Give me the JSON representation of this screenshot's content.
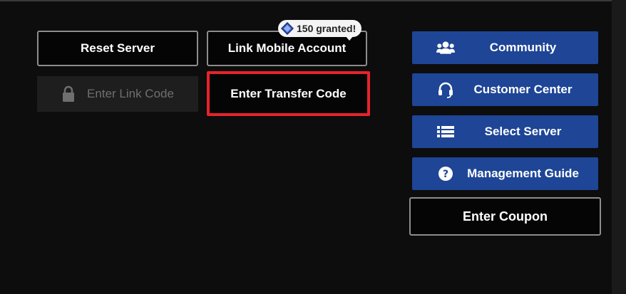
{
  "left_buttons": {
    "reset_server": "Reset Server",
    "link_mobile_account": "Link Mobile Account",
    "enter_link_code": "Enter Link Code",
    "enter_transfer_code": "Enter Transfer Code"
  },
  "badge": {
    "text": "150 granted!",
    "icon": "gem-icon"
  },
  "right_buttons": {
    "community": {
      "label": "Community",
      "icon": "people-icon"
    },
    "customer_center": {
      "label": "Customer Center",
      "icon": "headset-icon"
    },
    "select_server": {
      "label": "Select Server",
      "icon": "list-icon"
    },
    "management_guide": {
      "label": "Management Guide",
      "icon": "question-icon"
    },
    "enter_coupon": "Enter Coupon"
  },
  "colors": {
    "accent_blue": "#1e4596",
    "highlight_red": "#e8222c",
    "background": "#0d0d0d"
  }
}
